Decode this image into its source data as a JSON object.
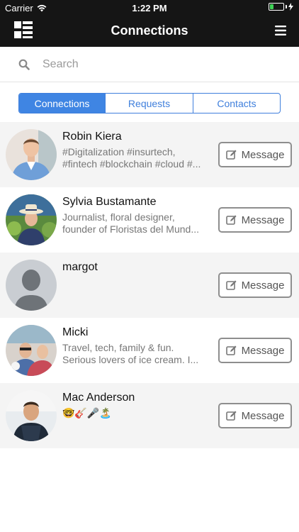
{
  "status_bar": {
    "carrier": "Carrier",
    "time": "1:22 PM"
  },
  "nav": {
    "title": "Connections"
  },
  "search": {
    "placeholder": "Search"
  },
  "tabs": [
    {
      "label": "Connections",
      "active": true
    },
    {
      "label": "Requests",
      "active": false
    },
    {
      "label": "Contacts",
      "active": false
    }
  ],
  "connections": [
    {
      "name": "Robin Kiera",
      "bio_line1": "#Digitalization #insurtech,",
      "bio_line2": "#fintech #blockchain #cloud #...",
      "button": "Message"
    },
    {
      "name": "Sylvia Bustamante",
      "bio_line1": "Journalist, floral designer,",
      "bio_line2": "founder of Floristas del Mund...",
      "button": "Message"
    },
    {
      "name": "margot",
      "bio_line1": "",
      "bio_line2": "",
      "button": "Message"
    },
    {
      "name": "Micki",
      "bio_line1": "Travel, tech, family & fun.",
      "bio_line2": "Serious lovers of ice cream. I...",
      "button": "Message"
    },
    {
      "name": "Mac Anderson",
      "bio_line1": "🤓🎸🎤🏝️",
      "bio_line2": "",
      "button": "Message"
    }
  ],
  "colors": {
    "accent": "#3f85e3",
    "navbar": "#151515",
    "battery": "#3fd157"
  }
}
